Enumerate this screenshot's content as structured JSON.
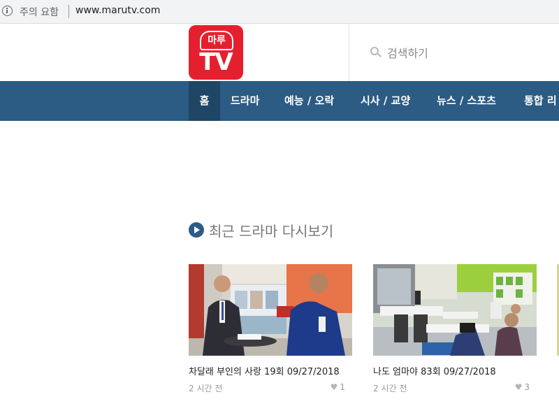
{
  "browser": {
    "security_warning": "주의 요함",
    "url": "www.marutv.com",
    "icons": {
      "info": "info-icon"
    }
  },
  "header": {
    "logo": {
      "top_text": "마루",
      "main_text": "TV",
      "color": "#e5202e"
    },
    "search": {
      "placeholder": "검색하기",
      "icon": "search-icon"
    }
  },
  "nav": {
    "bg_color": "#2c5b84",
    "active_color": "#204665",
    "items": [
      {
        "label": "홈",
        "active": true
      },
      {
        "label": "드라마"
      },
      {
        "label": "예능 / 오락"
      },
      {
        "label": "시사 / 교양"
      },
      {
        "label": "뉴스 / 스포츠"
      },
      {
        "label": "통합 리"
      }
    ]
  },
  "section": {
    "title": "최근 드라마 다시보기",
    "icon": "play-circle-icon"
  },
  "cards": [
    {
      "title": "차달래 부인의 사랑 19회 09/27/2018",
      "time": "2 시간 전",
      "likes": "1"
    },
    {
      "title": "나도 엄마야 83회 09/27/2018",
      "time": "2 시간 전",
      "likes": "3"
    }
  ]
}
